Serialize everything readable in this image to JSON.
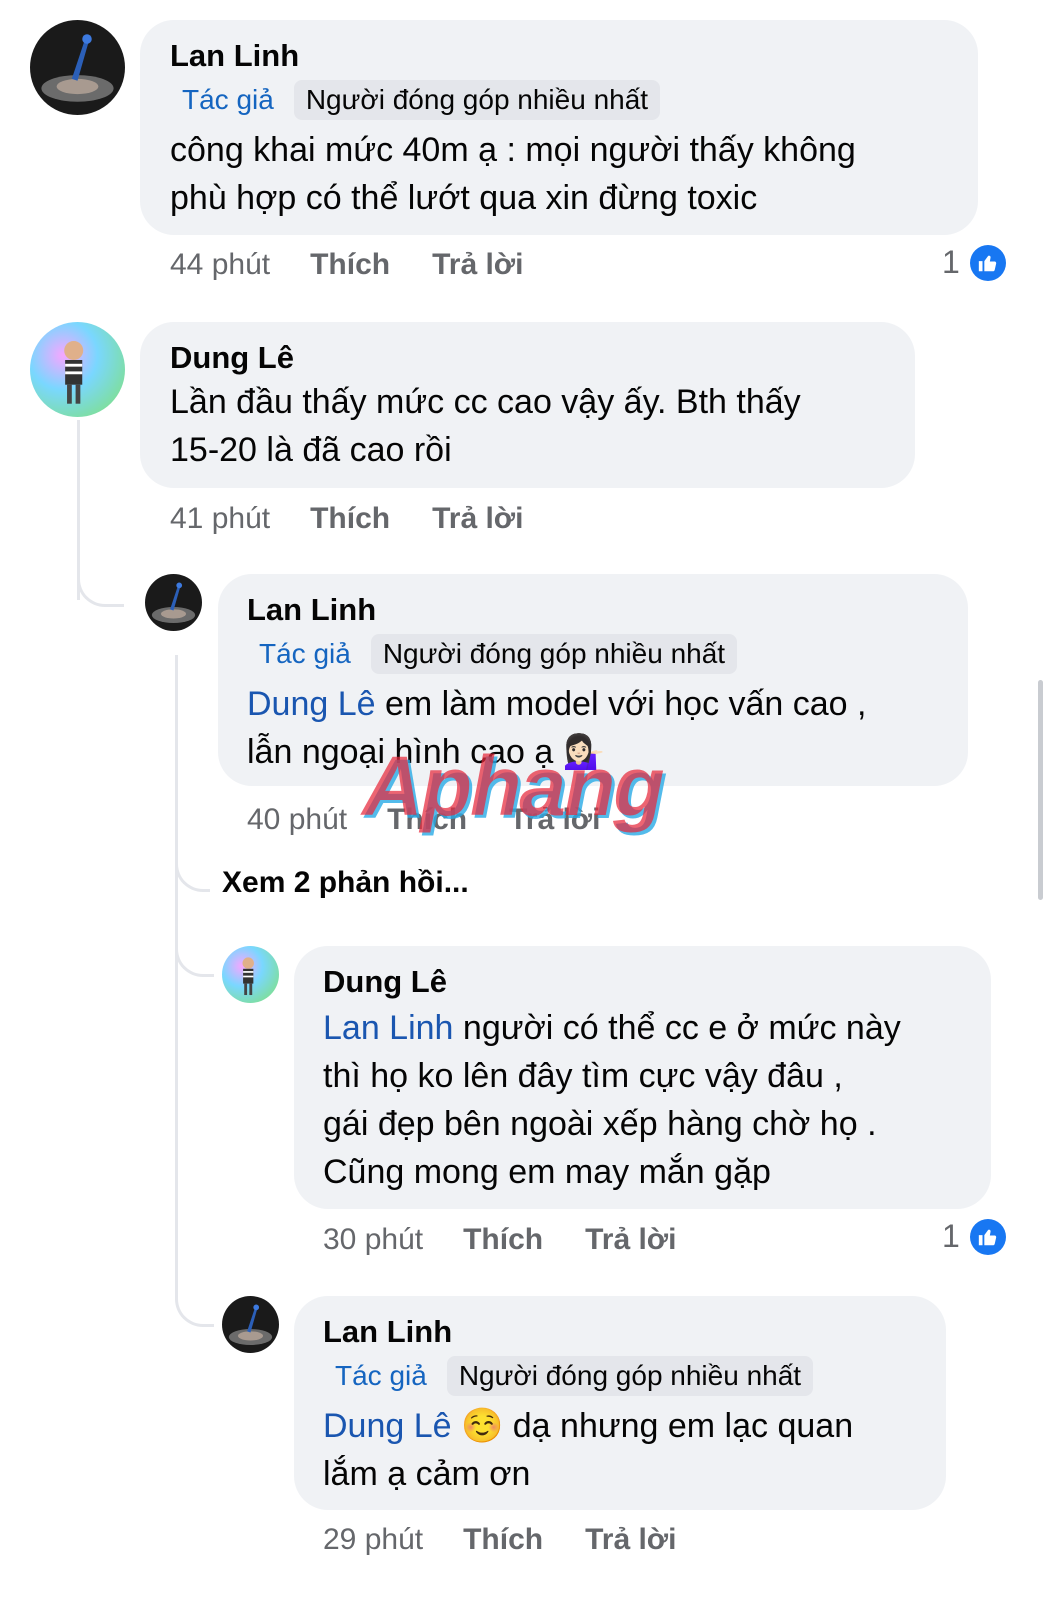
{
  "comments": [
    {
      "author": "Lan Linh",
      "badges": {
        "author": "Tác giả",
        "top": "Người đóng góp nhiều nhất"
      },
      "text_line1": "công khai mức 40m ạ : mọi người thấy không",
      "text_line2": "phù hợp có thể lướt qua xin đừng toxic",
      "time": "44 phút",
      "like": "Thích",
      "reply": "Trả lời",
      "reaction_count": "1"
    },
    {
      "author": "Dung Lê",
      "text_line1": "Lần đầu thấy mức cc cao vậy ấy. Bth thấy",
      "text_line2": "15-20 là đã cao rồi",
      "time": "41 phút",
      "like": "Thích",
      "reply": "Trả lời"
    },
    {
      "author": "Lan Linh",
      "badges": {
        "author": "Tác giả",
        "top": "Người đóng góp nhiều nhất"
      },
      "mention": "Dung Lê",
      "text_line1": " em làm model với học vấn cao ,",
      "text_line2": "lẫn ngoại hình cao ạ 💁🏻‍♀️",
      "time": "40 phút",
      "like": "Thích",
      "reply": "Trả lời"
    },
    {
      "author": "Dung Lê",
      "mention": "Lan Linh",
      "text_line1": " người có thể cc e ở mức này",
      "text_line2": "thì họ ko lên đây tìm cực vậy đâu ,",
      "text_line3": "gái đẹp bên ngoài xếp hàng chờ họ .",
      "text_line4": "Cũng mong em may mắn gặp",
      "time": "30 phút",
      "like": "Thích",
      "reply": "Trả lời",
      "reaction_count": "1"
    },
    {
      "author": "Lan Linh",
      "badges": {
        "author": "Tác giả",
        "top": "Người đóng góp nhiều nhất"
      },
      "mention": "Dung Lê",
      "text_line1": " ☺️ dạ nhưng em lạc quan",
      "text_line2": "lắm ạ cảm ơn",
      "time": "29 phút",
      "like": "Thích",
      "reply": "Trả lời"
    }
  ],
  "view_more_replies": "Xem 2 phản hồi...",
  "watermark": "Aphang",
  "icons": {
    "like": "like-thumb-icon"
  },
  "colors": {
    "mention": "#1a56b0",
    "like_blue": "#1877f2",
    "bubble": "#f0f2f5"
  }
}
